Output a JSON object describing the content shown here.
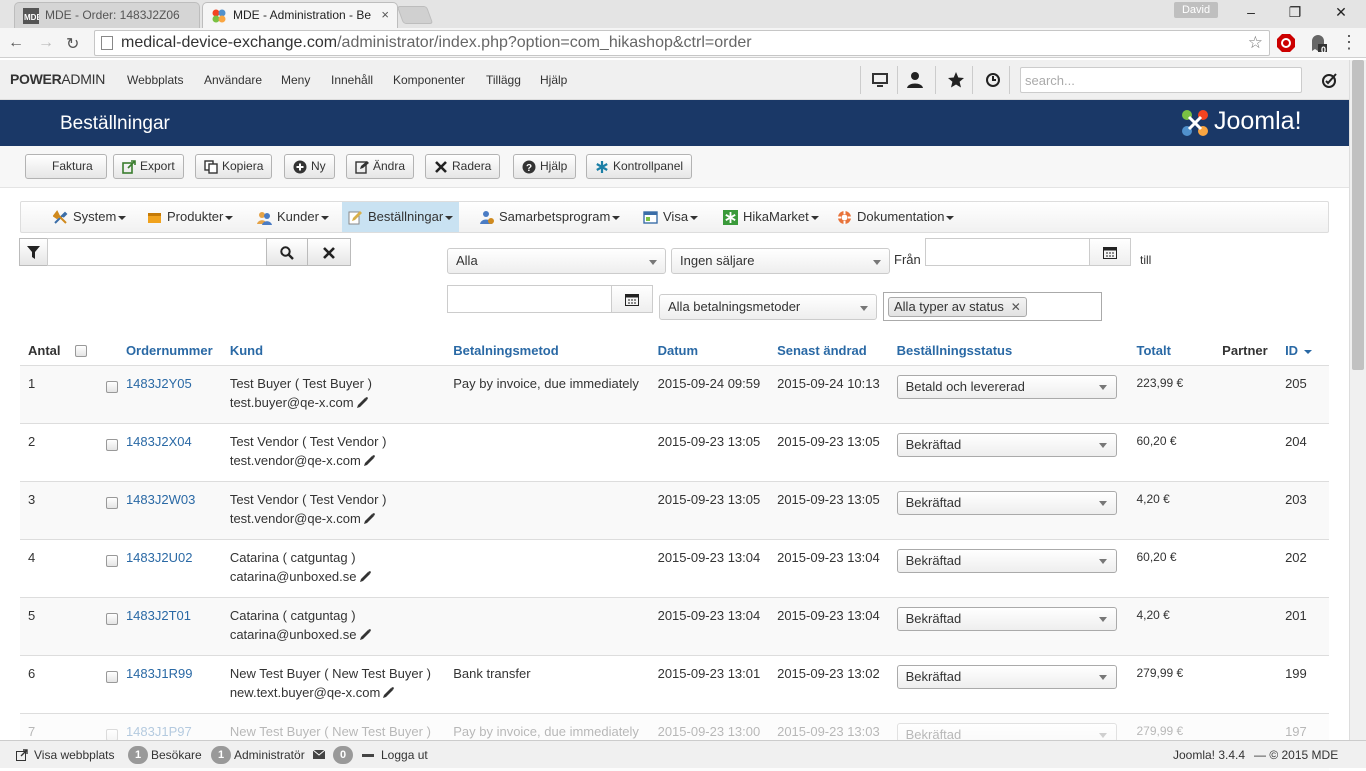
{
  "browser": {
    "tabs": [
      {
        "label": "MDE - Order: 1483J2Z06",
        "close": "×"
      },
      {
        "label": "MDE - Administration - Be",
        "close": "×"
      }
    ],
    "user": "David",
    "window_controls": {
      "minimize": "–",
      "maximize": "❐",
      "close": "✕"
    },
    "url_host": "medical-device-exchange.com",
    "url_path": "/administrator/index.php?option=com_hikashop&ctrl=order",
    "ext_badge": "0"
  },
  "admin_nav": {
    "brand_bold": "POWER",
    "brand_rest": "ADMIN",
    "menu": [
      "Webbplats",
      "Användare",
      "Meny",
      "Innehåll",
      "Komponenter",
      "Tillägg",
      "Hjälp"
    ],
    "search_placeholder": "search..."
  },
  "header": {
    "title": "Beställningar",
    "logo_text": "Joomla!"
  },
  "toolbar": {
    "buttons": [
      "Faktura",
      "Export",
      "Kopiera",
      "Ny",
      "Ändra",
      "Radera",
      "Hjälp",
      "Kontrollpanel"
    ]
  },
  "hika_menu": {
    "items": [
      "System",
      "Produkter",
      "Kunder",
      "Beställningar",
      "Samarbetsprogram",
      "Visa",
      "HikaMarket",
      "Dokumentation"
    ]
  },
  "filters": {
    "status_select": "Alla",
    "vendor_select": "Ingen säljare",
    "from_label": "Från",
    "to_label": "till",
    "payment_select": "Alla betalningsmetoder",
    "status_chip": "Alla typer av status",
    "chip_remove": "✕"
  },
  "table": {
    "headers": [
      "Antal",
      "",
      "Ordernummer",
      "Kund",
      "Betalningsmetod",
      "Datum",
      "Senast ändrad",
      "Beställningsstatus",
      "Totalt",
      "Partner",
      "ID"
    ],
    "rows": [
      {
        "n": "1",
        "order": "1483J2Y05",
        "customer": "Test Buyer ( Test Buyer )",
        "email": "test.buyer@qe-x.com",
        "payment": "Pay by invoice, due immediately",
        "date": "2015-09-24 09:59",
        "modified": "2015-09-24 10:13",
        "status": "Betald och levererad",
        "total": "223,99 €",
        "partner": "",
        "id": "205"
      },
      {
        "n": "2",
        "order": "1483J2X04",
        "customer": "Test Vendor ( Test Vendor )",
        "email": "test.vendor@qe-x.com",
        "payment": "",
        "date": "2015-09-23 13:05",
        "modified": "2015-09-23 13:05",
        "status": "Bekräftad",
        "total": "60,20 €",
        "partner": "",
        "id": "204"
      },
      {
        "n": "3",
        "order": "1483J2W03",
        "customer": "Test Vendor ( Test Vendor )",
        "email": "test.vendor@qe-x.com",
        "payment": "",
        "date": "2015-09-23 13:05",
        "modified": "2015-09-23 13:05",
        "status": "Bekräftad",
        "total": "4,20 €",
        "partner": "",
        "id": "203"
      },
      {
        "n": "4",
        "order": "1483J2U02",
        "customer": "Catarina ( catguntag )",
        "email": "catarina@unboxed.se",
        "payment": "",
        "date": "2015-09-23 13:04",
        "modified": "2015-09-23 13:04",
        "status": "Bekräftad",
        "total": "60,20 €",
        "partner": "",
        "id": "202"
      },
      {
        "n": "5",
        "order": "1483J2T01",
        "customer": "Catarina ( catguntag )",
        "email": "catarina@unboxed.se",
        "payment": "",
        "date": "2015-09-23 13:04",
        "modified": "2015-09-23 13:04",
        "status": "Bekräftad",
        "total": "4,20 €",
        "partner": "",
        "id": "201"
      },
      {
        "n": "6",
        "order": "1483J1R99",
        "customer": "New Test Buyer ( New Test Buyer )",
        "email": "new.text.buyer@qe-x.com",
        "payment": "Bank transfer",
        "date": "2015-09-23 13:01",
        "modified": "2015-09-23 13:02",
        "status": "Bekräftad",
        "total": "279,99 €",
        "partner": "",
        "id": "199"
      },
      {
        "n": "7",
        "order": "1483J1P97",
        "customer": "New Test Buyer ( New Test Buyer )",
        "email": "",
        "payment": "Pay by invoice, due immediately",
        "date": "2015-09-23 13:00",
        "modified": "2015-09-23 13:03",
        "status": "Bekräftad",
        "total": "279,99 €",
        "partner": "",
        "id": "197"
      }
    ]
  },
  "footer": {
    "view_site": "Visa webbplats",
    "visitors_count": "1",
    "visitors_label": "Besökare",
    "admins_count": "1",
    "admins_label": "Administratör",
    "messages_count": "0",
    "logout": "Logga ut",
    "version": "Joomla! 3.4.4",
    "copyright": "— © 2015 MDE"
  },
  "colors": {
    "header_bg": "#1a3867",
    "link": "#2a69a5",
    "active_menu": "#c9e2f2"
  }
}
